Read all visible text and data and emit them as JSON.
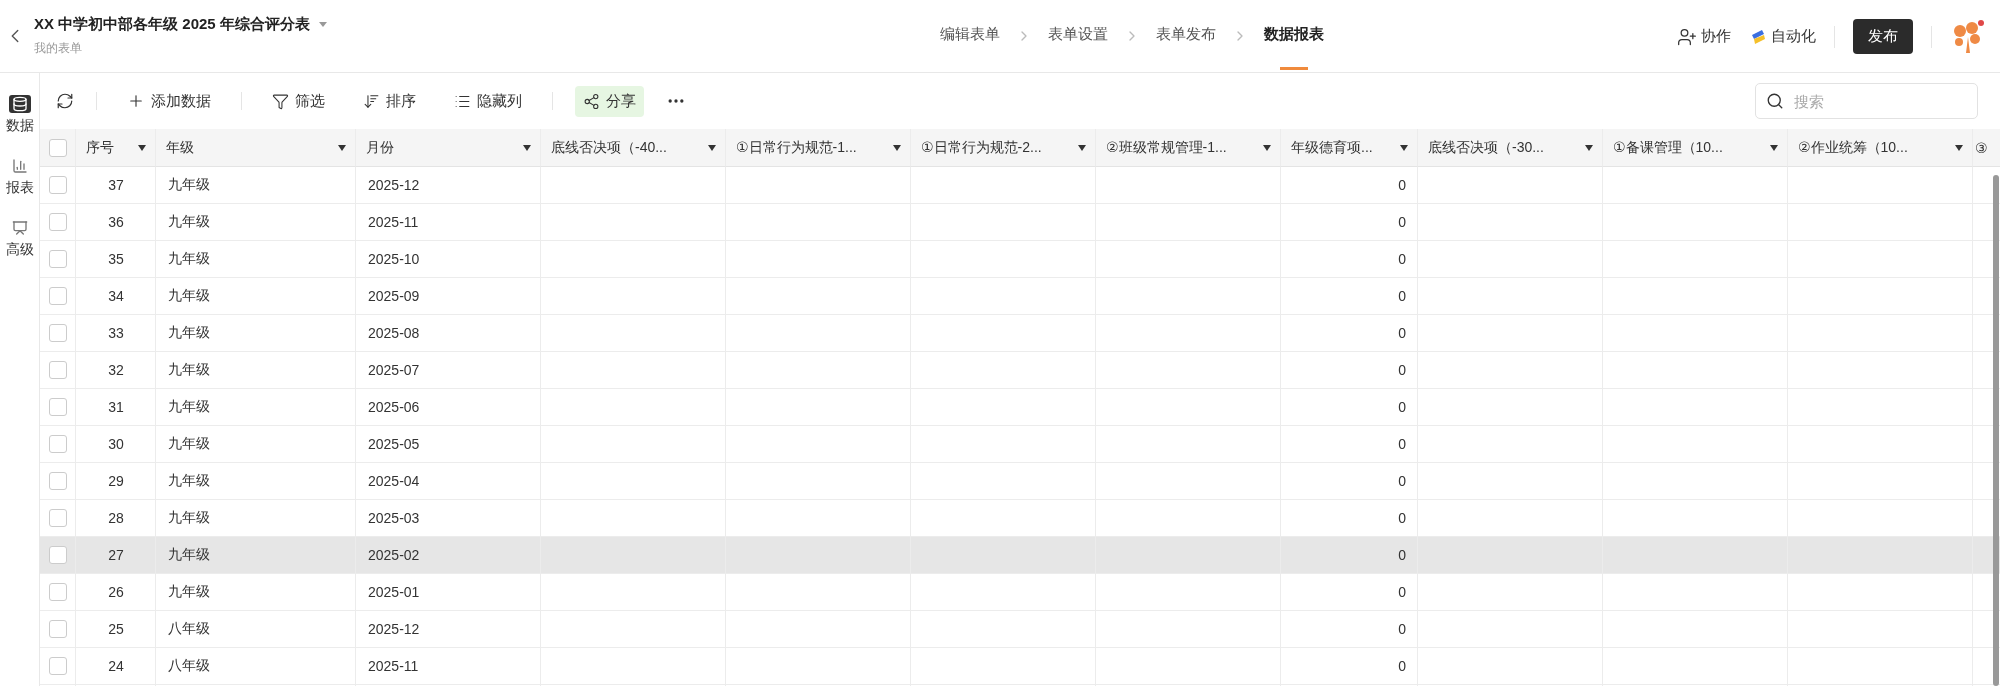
{
  "header": {
    "title": "XX 中学初中部各年级 2025 年综合评分表",
    "subtitle": "我的表单",
    "steps": [
      {
        "label": "编辑表单",
        "selected": false
      },
      {
        "label": "表单设置",
        "selected": false
      },
      {
        "label": "表单发布",
        "selected": false
      },
      {
        "label": "数据报表",
        "selected": true
      }
    ],
    "collaborate": "协作",
    "automation": "自动化",
    "publish": "发布"
  },
  "sidebar": {
    "items": [
      {
        "label": "数据",
        "kind": "data",
        "selected": true
      },
      {
        "label": "报表",
        "kind": "report",
        "selected": false
      },
      {
        "label": "高级",
        "kind": "advanced",
        "selected": false
      }
    ]
  },
  "toolbar": {
    "add": "添加数据",
    "filter": "筛选",
    "sort": "排序",
    "hide": "隐藏列",
    "share": "分享",
    "search_placeholder": "搜索"
  },
  "table": {
    "select_all_checked": false,
    "columns": [
      {
        "label": "序号",
        "kind": "number"
      },
      {
        "label": "年级",
        "kind": "grade"
      },
      {
        "label": "月份",
        "kind": "month"
      },
      {
        "label": "底线否决项（-40...",
        "kind": "empty"
      },
      {
        "label": "①日常行为规范-1...",
        "kind": "empty"
      },
      {
        "label": "①日常行为规范-2...",
        "kind": "empty"
      },
      {
        "label": "②班级常规管理-1...",
        "kind": "empty"
      },
      {
        "label": "年级德育项...",
        "kind": "score"
      },
      {
        "label": "底线否决项（-30...",
        "kind": "empty"
      },
      {
        "label": "①备课管理（10...",
        "kind": "empty"
      },
      {
        "label": "②作业统筹（10...",
        "kind": "empty"
      },
      {
        "label": "③",
        "kind": "partial"
      }
    ],
    "rows": [
      {
        "number": "37",
        "grade": "九年级",
        "month": "2025-12",
        "score": "0",
        "checked": false,
        "hovered": false
      },
      {
        "number": "36",
        "grade": "九年级",
        "month": "2025-11",
        "score": "0",
        "checked": false,
        "hovered": false
      },
      {
        "number": "35",
        "grade": "九年级",
        "month": "2025-10",
        "score": "0",
        "checked": false,
        "hovered": false
      },
      {
        "number": "34",
        "grade": "九年级",
        "month": "2025-09",
        "score": "0",
        "checked": false,
        "hovered": false
      },
      {
        "number": "33",
        "grade": "九年级",
        "month": "2025-08",
        "score": "0",
        "checked": false,
        "hovered": false
      },
      {
        "number": "32",
        "grade": "九年级",
        "month": "2025-07",
        "score": "0",
        "checked": false,
        "hovered": false
      },
      {
        "number": "31",
        "grade": "九年级",
        "month": "2025-06",
        "score": "0",
        "checked": false,
        "hovered": false
      },
      {
        "number": "30",
        "grade": "九年级",
        "month": "2025-05",
        "score": "0",
        "checked": false,
        "hovered": false
      },
      {
        "number": "29",
        "grade": "九年级",
        "month": "2025-04",
        "score": "0",
        "checked": false,
        "hovered": false
      },
      {
        "number": "28",
        "grade": "九年级",
        "month": "2025-03",
        "score": "0",
        "checked": false,
        "hovered": false
      },
      {
        "number": "27",
        "grade": "九年级",
        "month": "2025-02",
        "score": "0",
        "checked": false,
        "hovered": true
      },
      {
        "number": "26",
        "grade": "九年级",
        "month": "2025-01",
        "score": "0",
        "checked": false,
        "hovered": false
      },
      {
        "number": "25",
        "grade": "八年级",
        "month": "2025-12",
        "score": "0",
        "checked": false,
        "hovered": false
      },
      {
        "number": "24",
        "grade": "八年级",
        "month": "2025-11",
        "score": "0",
        "checked": false,
        "hovered": false
      }
    ]
  }
}
